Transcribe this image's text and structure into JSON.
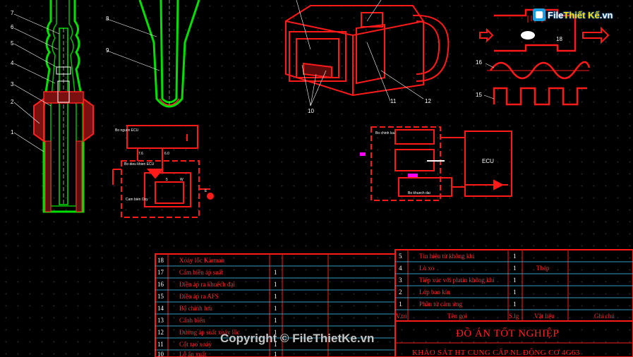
{
  "logo": {
    "prefix": "File",
    "accent": "Thiết Kế",
    "suffix": ".vn"
  },
  "watermark": "Copyright © FileThietKe.vn",
  "callouts": {
    "sensor": [
      "1",
      "2",
      "3",
      "4",
      "5",
      "6",
      "7"
    ],
    "tube": [
      "8",
      "9"
    ],
    "afs": [
      "10",
      "11",
      "12"
    ],
    "waves": [
      "15",
      "16"
    ],
    "vortex": "18"
  },
  "circuit_left": {
    "title_top": "Bo nguon ECU",
    "title_bottom": "Cam bien Oxy",
    "mid": "Bo dieu khien ECU",
    "pins": [
      "7.6",
      "6.0",
      "5",
      "W",
      "E"
    ]
  },
  "circuit_right": {
    "ecu": "ECU",
    "block1": "Bo chinh luu",
    "block2": "Bo khuech dai"
  },
  "parts_left": [
    {
      "no": "18",
      "name": "Xoáy lốc Karman",
      "qty": ""
    },
    {
      "no": "17",
      "name": "Cảm biến áp suất",
      "qty": "1"
    },
    {
      "no": "16",
      "name": "Điện áp ra khuếch đại",
      "qty": "1"
    },
    {
      "no": "15",
      "name": "Điện áp ra AFS",
      "qty": "1"
    },
    {
      "no": "14",
      "name": "Bộ chỉnh lưu",
      "qty": "1"
    },
    {
      "no": "13",
      "name": "Cánh biến",
      "qty": "1"
    },
    {
      "no": "12",
      "name": "Đường áp suất xoáy lốc",
      "qty": "1"
    },
    {
      "no": "11",
      "name": "Cột tạo xoáy",
      "qty": "1"
    },
    {
      "no": "10",
      "name": "Lỗ ẩn xuất",
      "qty": "1"
    }
  ],
  "parts_right": [
    {
      "no": "5",
      "name": "Tín hiệu từ không khí",
      "qty": "1",
      "material": ""
    },
    {
      "no": "4",
      "name": "Lò xo",
      "qty": "1",
      "material": "Thép"
    },
    {
      "no": "3",
      "name": "Tiếp xúc với platin không khí",
      "qty": "1",
      "material": ""
    },
    {
      "no": "2",
      "name": "Lớp bao kín",
      "qty": "1",
      "material": ""
    },
    {
      "no": "1",
      "name": "Phần tử cảm ứng",
      "qty": "1",
      "material": ""
    }
  ],
  "table_header": {
    "no": "V.trí",
    "name": "Tên gọi",
    "qty": "S.lg",
    "material": "Vật liệu",
    "note": "Ghi chú"
  },
  "title_block": {
    "line1": "ĐỒ ÁN TỐT NGHIỆP",
    "line2": "KHẢO SÁT HT CUNG CẤP NL ĐỘNG CƠ 4G63"
  }
}
